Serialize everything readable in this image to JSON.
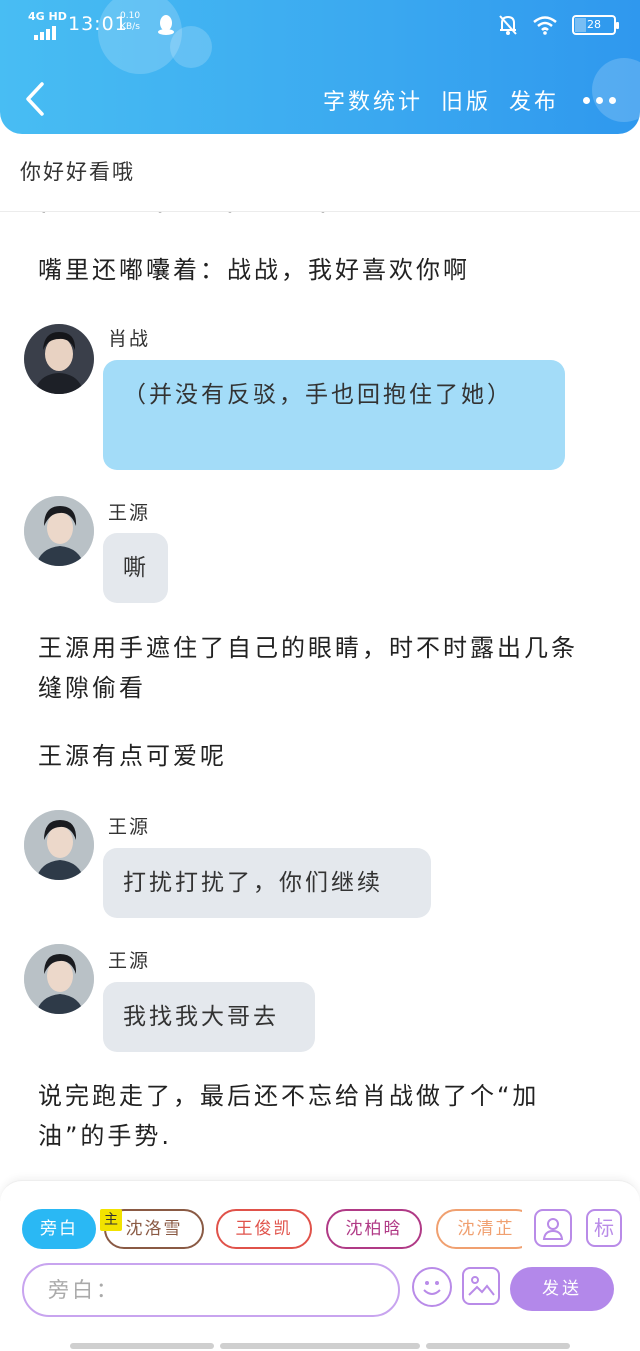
{
  "status_bar": {
    "network": "4G HD",
    "time": "13:01",
    "speed_value": "0.10",
    "speed_unit": "KB/s",
    "battery": "28"
  },
  "nav": {
    "word_count": "字数统计",
    "old_version": "旧版",
    "publish": "发布"
  },
  "title": "你好好看哦",
  "story": [
    {
      "type": "narration",
      "text": "嘴里还嘟囔着：战战，我好喜欢你啊"
    },
    {
      "type": "message",
      "speaker": "肖战",
      "text": "（并没有反驳，手也回抱住了她）",
      "style": "blue"
    },
    {
      "type": "message",
      "speaker": "王源",
      "text": "嘶",
      "style": "gray"
    },
    {
      "type": "narration",
      "text": "王源用手遮住了自己的眼睛，时不时露出几条缝隙偷看"
    },
    {
      "type": "narration",
      "text": "王源有点可爱呢"
    },
    {
      "type": "message",
      "speaker": "王源",
      "text": "打扰打扰了，你们继续",
      "style": "gray"
    },
    {
      "type": "message",
      "speaker": "王源",
      "text": "我找我大哥去",
      "style": "gray"
    },
    {
      "type": "narration",
      "text": "说完跑走了，最后还不忘给肖战做了个“加油”的手势."
    }
  ],
  "composer": {
    "characters": [
      {
        "label": "旁白",
        "color": "#2ab8f4",
        "active": true
      },
      {
        "label": "沈洛雪",
        "color": "#8a5a44",
        "active": false
      },
      {
        "label": "王俊凯",
        "color": "#e0524a",
        "active": false
      },
      {
        "label": "沈柏晗",
        "color": "#b03a86",
        "active": false
      },
      {
        "label": "沈清芷",
        "color": "#f0a070",
        "active": false
      }
    ],
    "main_badge": "主",
    "mark_label": "标",
    "input_placeholder": "旁白：",
    "send_label": "发送",
    "accent_color": "#b388ea"
  }
}
